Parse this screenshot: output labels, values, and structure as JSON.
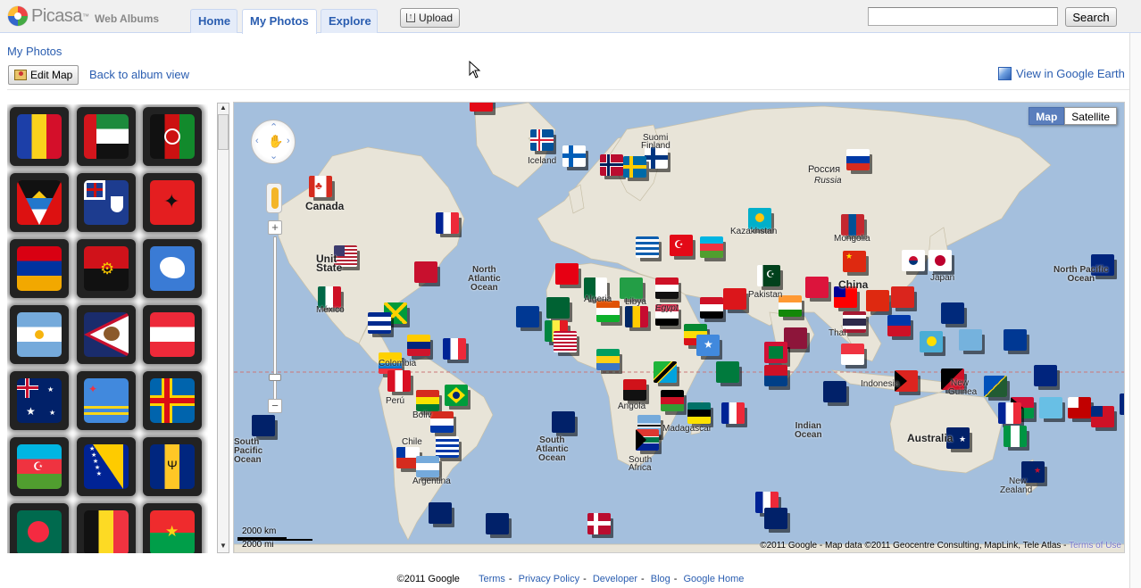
{
  "app": {
    "brand": "Picasa",
    "tm": "™",
    "subtitle": "Web Albums"
  },
  "tabs": [
    {
      "label": "Home"
    },
    {
      "label": "My Photos"
    },
    {
      "label": "Explore"
    }
  ],
  "toolbar": {
    "upload_label": "Upload",
    "search_placeholder": "",
    "search_value": "",
    "search_label": "Search"
  },
  "breadcrumb": "My Photos",
  "actions": {
    "edit_map_label": "Edit Map",
    "back_label": "Back to album view",
    "earth_label": "View in Google Earth"
  },
  "thumbnails": [
    {
      "name": "andorra"
    },
    {
      "name": "uae"
    },
    {
      "name": "afghanistan"
    },
    {
      "name": "antigua"
    },
    {
      "name": "anguilla"
    },
    {
      "name": "albania"
    },
    {
      "name": "armenia"
    },
    {
      "name": "angola"
    },
    {
      "name": "antarctica"
    },
    {
      "name": "argentina"
    },
    {
      "name": "american-samoa"
    },
    {
      "name": "austria"
    },
    {
      "name": "australia"
    },
    {
      "name": "aruba"
    },
    {
      "name": "aland"
    },
    {
      "name": "azerbaijan"
    },
    {
      "name": "bosnia"
    },
    {
      "name": "barbados"
    },
    {
      "name": "bangladesh"
    },
    {
      "name": "belgium"
    },
    {
      "name": "burkina-faso"
    }
  ],
  "map": {
    "type_buttons": [
      {
        "label": "Map",
        "active": true
      },
      {
        "label": "Satellite",
        "active": false
      }
    ],
    "scale_km": "2000 km",
    "scale_mi": "2000 mi",
    "copyright": "©2011 Google - Map data ©2011 Geocentre Consulting, MapLink, Tele Atlas - ",
    "terms": "Terms of Use",
    "labels": {
      "suomi": "Suomi",
      "finland": "Finland",
      "iceland": "Iceland",
      "rossiya": "Россия",
      "russia": "Russia",
      "canada": "Canada",
      "us1": "Unit",
      "us2": "State",
      "mexico": "México",
      "kazakh": "Kazakhstan",
      "mongolia": "Mongolia",
      "china": "China",
      "japan": "Japan",
      "pakistan": "Pakistan",
      "libya": "Libya",
      "egypt": "Egypt",
      "algeria": "Algeria",
      "thai": "Thai",
      "indonesia": "Indonesia",
      "newguinea1": "New",
      "newguinea2": "Guinea",
      "australia": "Australia",
      "newzealand1": "New",
      "newzealand2": "Zealand",
      "angola": "Angola",
      "madagascar": "Madagascar",
      "southafrica1": "South",
      "southafrica2": "Africa",
      "peru": "Perú",
      "bolivia": "Boliv",
      "chile": "Chile",
      "argentina": "Argentina",
      "colombia": "Colombia",
      "na_ocean": "North\nAtlantic\nOcean",
      "np_ocean": "North Pacific\nOcean",
      "sa_ocean": "South\nAtlantic\nOcean",
      "in_ocean": "Indian\nOcean",
      "sp_ocean": "South\nPacific\nOcean"
    }
  },
  "footer": {
    "copyright": "©2011 Google",
    "links": [
      "Terms",
      "Privacy Policy",
      "Developer",
      "Blog",
      "Google Home"
    ]
  },
  "colors": {
    "link": "#2a5db0",
    "water": "#a4bfdd",
    "land": "#e7e3d8",
    "active_tab_bg": "#ffffff",
    "tab_bg": "#e5ecf9"
  }
}
